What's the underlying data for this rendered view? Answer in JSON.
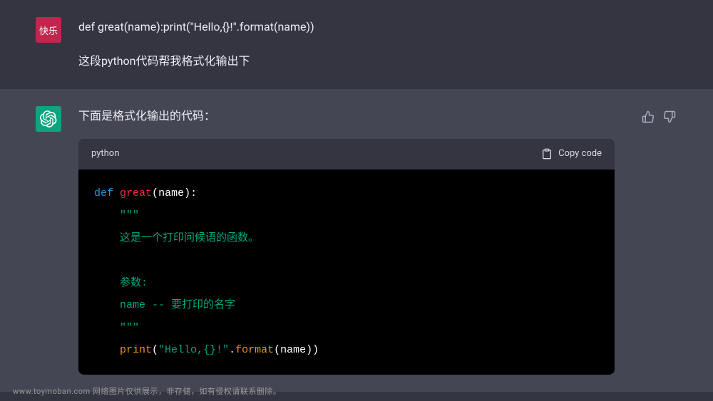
{
  "user": {
    "avatar_text": "快乐",
    "line1": "def great(name):print(\"Hello,{}!\".format(name))",
    "line2": "这段python代码帮我格式化输出下"
  },
  "assistant": {
    "intro": "下面是格式化输出的代码：",
    "code_header": {
      "language": "python",
      "copy_label": "Copy code"
    },
    "code": {
      "def_kw": "def",
      "func_name": "great",
      "param": "name",
      "triple_quote": "\"\"\"",
      "doc_line1": "这是一个打印问候语的函数。",
      "doc_line2": "参数:",
      "doc_line3": "name -- 要打印的名字",
      "print_name": "print",
      "hello_str": "\"Hello,{}!\"",
      "format_name": "format"
    }
  },
  "watermark": "www.toymoban.com 网络图片仅供展示，非存储，如有侵权请联系删除。"
}
